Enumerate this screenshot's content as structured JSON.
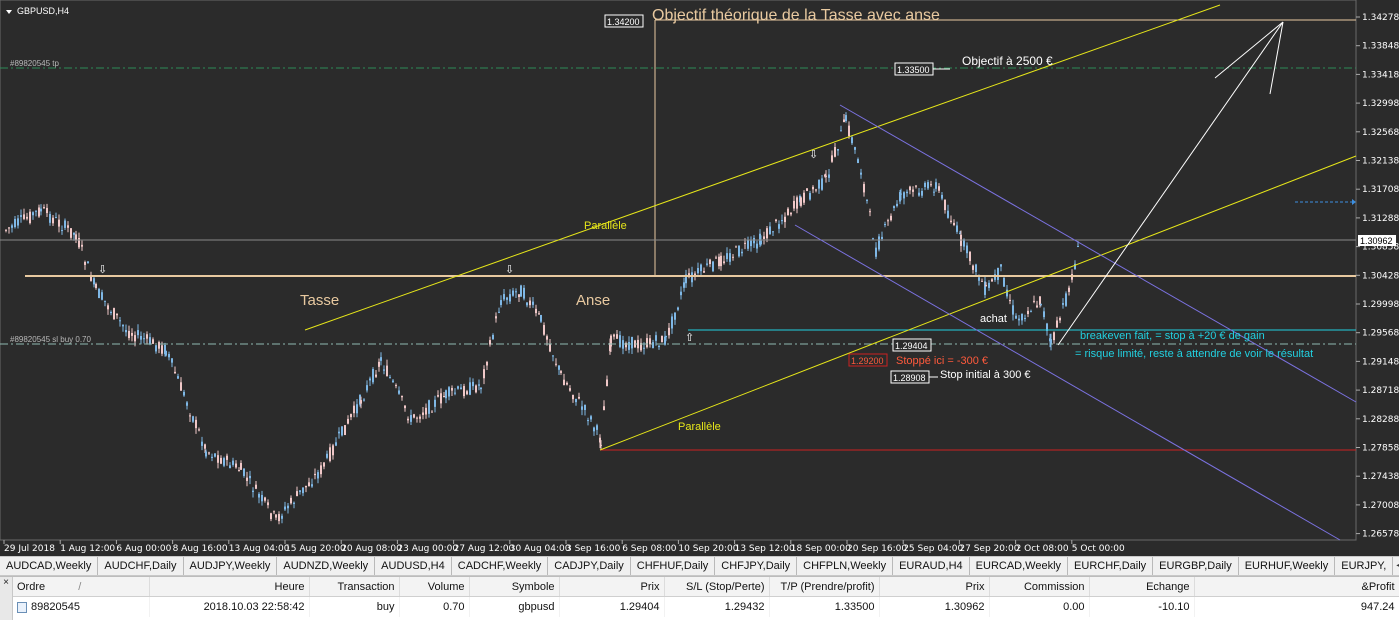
{
  "chart": {
    "symbol_label": "GBPUSD,H4",
    "background": "#2b2b2b",
    "bull_candle_color": "#7fb8e6",
    "bear_candle_color": "#f0c8c8",
    "price_ticks": [
      "1.34278",
      "1.33848",
      "1.33418",
      "1.32998",
      "1.32568",
      "1.32138",
      "1.31708",
      "1.31288",
      "1.30858",
      "1.30428",
      "1.29998",
      "1.29568",
      "1.29148",
      "1.28718",
      "1.28288",
      "1.27858",
      "1.27438",
      "1.27008",
      "1.26578"
    ],
    "current_price": "1.30962",
    "time_ticks": [
      "29 Jul 2018",
      "1 Aug 12:00",
      "6 Aug 00:00",
      "8 Aug 16:00",
      "13 Aug 04:00",
      "15 Aug 20:00",
      "20 Aug 08:00",
      "23 Aug 00:00",
      "27 Aug 12:00",
      "30 Aug 04:00",
      "3 Sep 16:00",
      "6 Sep 08:00",
      "10 Sep 20:00",
      "13 Sep 12:00",
      "18 Sep 00:00",
      "20 Sep 16:00",
      "25 Sep 04:00",
      "27 Sep 20:00",
      "2 Oct 08:00",
      "5 Oct 00:00"
    ],
    "tp_tag": "#89820545 tp",
    "order_tag": "#89820545 sl buy 0.70",
    "annotations": {
      "title": "Objectif théorique de la Tasse avec anse",
      "target_price_box": "1.34200",
      "objective_box": "1.33500",
      "objective_text": "Objectif à 2500 €",
      "tasse": "Tasse",
      "anse": "Anse",
      "parallele_top": "Parallèle",
      "parallele_bottom": "Parallèle",
      "achat": "achat",
      "entry_box": "1.29404",
      "stopped_box": "1.29200",
      "stopped_text": "Stoppé ici = -300 €",
      "initial_stop_box": "1.28908",
      "initial_stop_text": "Stop initial à 300 €",
      "breakeven_line1": "breakeven fait, = stop à +20 € de gain",
      "breakeven_line2": "= risque limité, reste à attendre de voir le résultat"
    },
    "colors": {
      "channel_line": "#e6e61a",
      "down_channel": "#7b72e0",
      "level_line": "#e8c9a0",
      "tp_line": "#2e8b57",
      "stopped_red": "#cc2222",
      "breakeven_cyan": "#22d0e0",
      "arrow_white": "#ffffff"
    }
  },
  "symbol_tabs": [
    "AUDCAD,Weekly",
    "AUDCHF,Daily",
    "AUDJPY,Weekly",
    "AUDNZD,Weekly",
    "AUDUSD,H4",
    "CADCHF,Weekly",
    "CADJPY,Daily",
    "CHFHUF,Daily",
    "CHFJPY,Daily",
    "CHFPLN,Weekly",
    "EURAUD,H4",
    "EURCAD,Weekly",
    "EURCHF,Daily",
    "EURGBP,Daily",
    "EURHUF,Weekly",
    "EURJPY,"
  ],
  "tab_nav": "◂ ▸",
  "terminal": {
    "close_glyph": "×",
    "columns": [
      "Ordre",
      "Heure",
      "Transaction",
      "Volume",
      "Symbole",
      "Prix",
      "S/L (Stop/Perte)",
      "T/P (Prendre/profit)",
      "Prix",
      "Commission",
      "Echange",
      "&Profit"
    ],
    "sort_glyph": "/",
    "rows": [
      [
        "89820545",
        "2018.10.03 22:58:42",
        "buy",
        "0.70",
        "gbpusd",
        "1.29404",
        "1.29432",
        "1.33500",
        "1.30962",
        "0.00",
        "-10.10",
        "947.24"
      ]
    ]
  }
}
